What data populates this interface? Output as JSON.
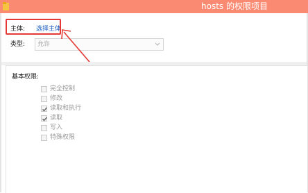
{
  "window": {
    "title": "hosts 的权限项目",
    "titlebar_color": "#fb8a72",
    "icon": "folder-icon"
  },
  "principal": {
    "label": "主体:",
    "link": "选择主体",
    "link_color": "#1b5fbf"
  },
  "type": {
    "label": "类型:",
    "selected": "允许",
    "icon": "chevron-down-icon"
  },
  "basic_permissions": {
    "label": "基本权限:",
    "items": [
      {
        "label": "完全控制",
        "checked": false
      },
      {
        "label": "修改",
        "checked": false
      },
      {
        "label": "读取和执行",
        "checked": true
      },
      {
        "label": "读取",
        "checked": true
      },
      {
        "label": "写入",
        "checked": false
      },
      {
        "label": "特殊权限",
        "checked": false
      }
    ]
  },
  "annotation": {
    "highlight_color": "#e53935"
  }
}
